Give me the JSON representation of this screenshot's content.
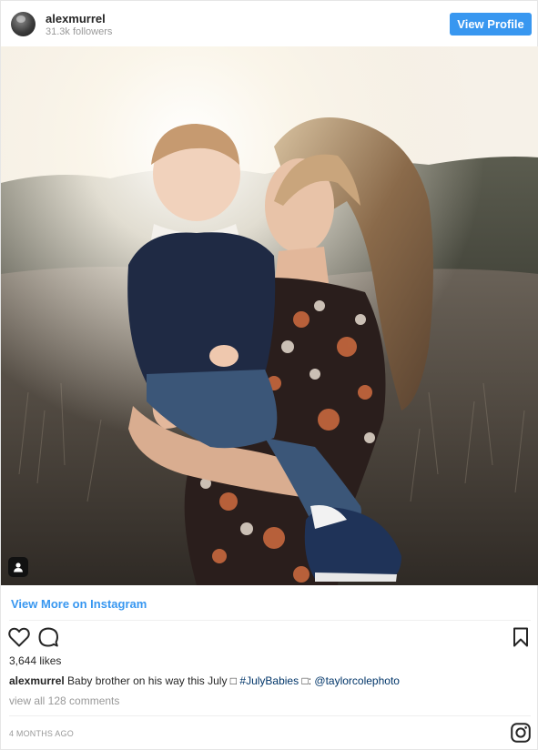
{
  "header": {
    "username": "alexmurrel",
    "followers": "31.3k followers",
    "view_profile_label": "View Profile"
  },
  "post": {
    "photo_alt": "Mother holding toddler in a sunlit field",
    "view_more_label": "View More on Instagram",
    "likes": "3,644 likes",
    "caption_user": "alexmurrel",
    "caption_text": "Baby brother on his way this July □",
    "caption_hashtag": "#JulyBabies",
    "caption_mid": "□:",
    "caption_mention": "@taylorcolephoto",
    "view_comments": "view all 128 comments",
    "timestamp": "4 MONTHS AGO"
  },
  "icons": {
    "avatar": "avatar",
    "user_tag": "user-tag-icon",
    "like": "heart-icon",
    "comment": "comment-icon",
    "save": "bookmark-icon",
    "brand": "instagram-icon"
  },
  "colors": {
    "link_blue": "#3897f0",
    "text": "#262626",
    "muted": "#999999",
    "hashtag": "#003569"
  }
}
